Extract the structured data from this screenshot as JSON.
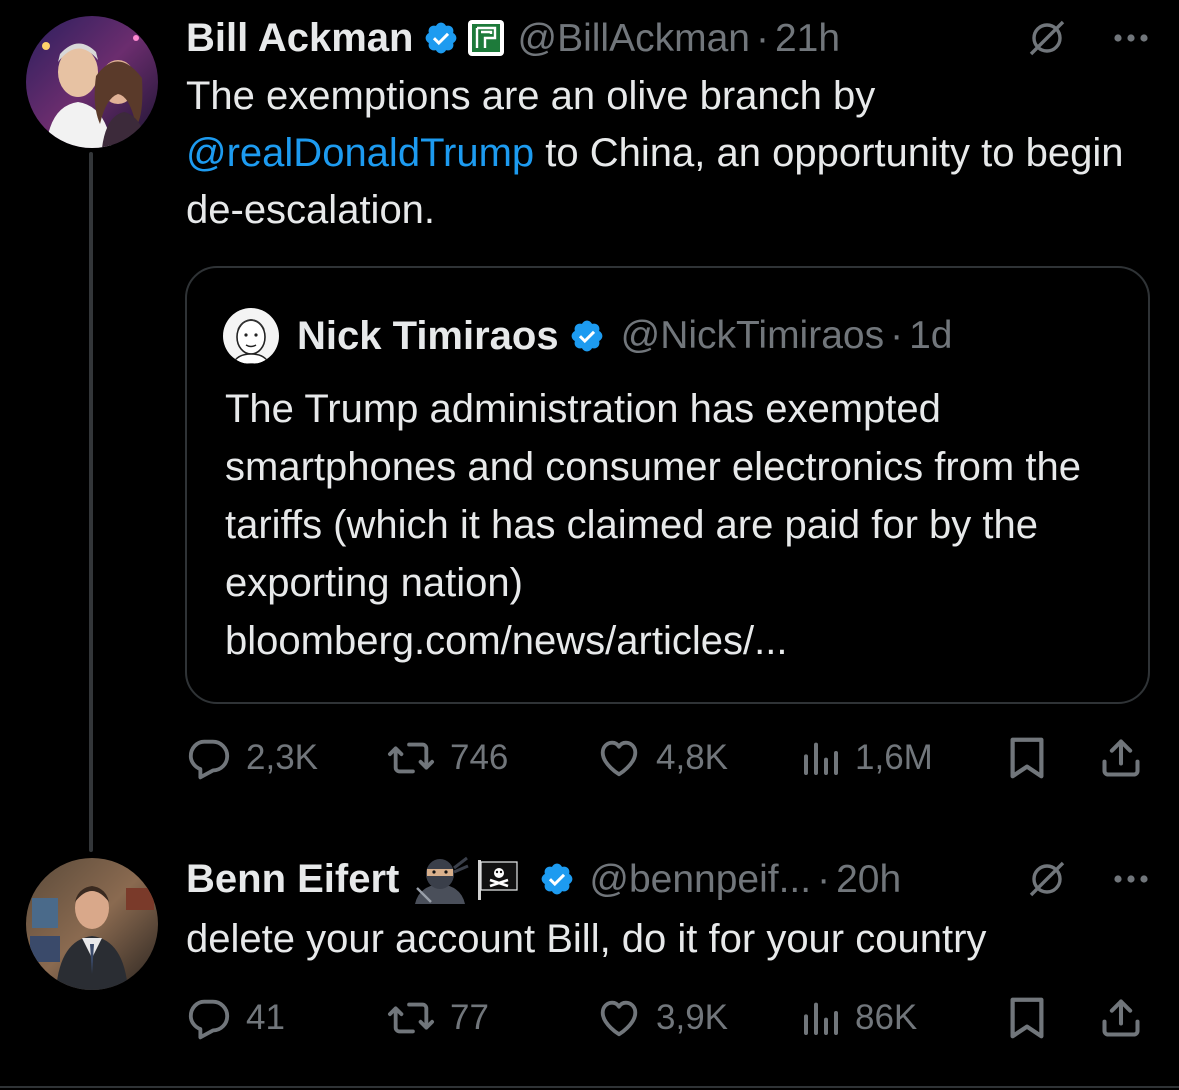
{
  "tweets": [
    {
      "display_name": "Bill Ackman",
      "handle": "@BillAckman",
      "separator": "·",
      "time": "21h",
      "text_before_mention": "The exemptions are an olive branch by ",
      "mention": "@realDonaldTrump",
      "text_after_mention": " to China, an opportunity to begin de-escalation.",
      "badges": [
        "verified-badge-icon",
        "affiliate-logo-icon"
      ],
      "quote": {
        "display_name": "Nick Timiraos",
        "handle": "@NickTimiraos",
        "separator": "·",
        "time": "1d",
        "text": "The Trump administration has exempted smartphones and consumer electronics from the tariffs (which it has claimed are paid for by the exporting nation)",
        "link": "bloomberg.com/news/articles/..."
      },
      "stats": {
        "replies": "2,3K",
        "reposts": "746",
        "likes": "4,8K",
        "views": "1,6M"
      }
    },
    {
      "display_name": "Benn Eifert",
      "name_emojis": [
        "ninja-emoji-icon",
        "pirate-flag-emoji-icon"
      ],
      "handle": "@bennpeif...",
      "separator": "·",
      "time": "20h",
      "text": "delete your account Bill, do it for your country",
      "stats": {
        "replies": "41",
        "reposts": "77",
        "likes": "3,9K",
        "views": "86K"
      }
    }
  ],
  "colors": {
    "background": "#000000",
    "text_primary": "#e7e9ea",
    "text_secondary": "#71767b",
    "accent": "#1d9bf0",
    "border": "#2f3336"
  }
}
